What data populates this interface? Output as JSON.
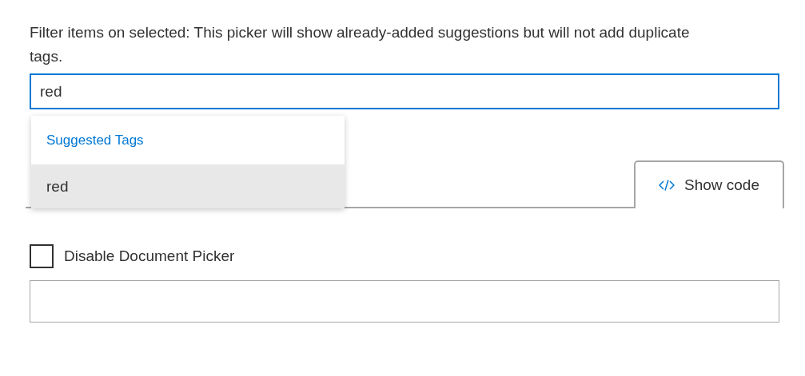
{
  "description": "Filter items on selected: This picker will show already-added suggestions but will not add duplicate tags.",
  "picker": {
    "value": "red",
    "focused": true
  },
  "suggestions": {
    "header": "Suggested Tags",
    "items": [
      {
        "label": "red",
        "selected": true
      }
    ]
  },
  "show_code_tab": {
    "label": "Show code"
  },
  "disable_checkbox": {
    "label": "Disable Document Picker",
    "checked": false
  }
}
